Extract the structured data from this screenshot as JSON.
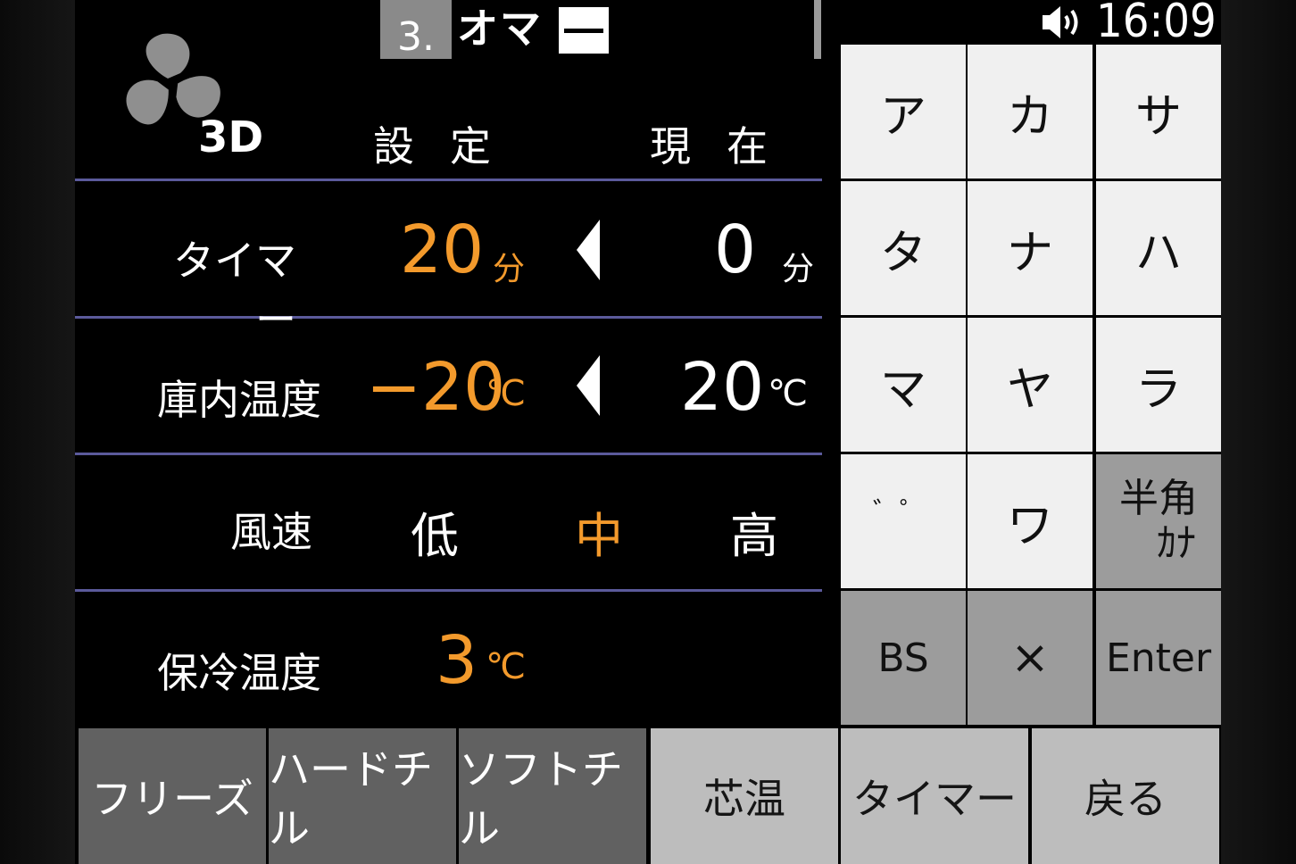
{
  "header": {
    "program_number": "3.",
    "program_name": "オマ",
    "clock": "16:09",
    "speaker_icon": "speaker-icon"
  },
  "mode": {
    "label": "3D",
    "fan_icon": "fan-icon"
  },
  "columns": {
    "set": "設定",
    "current": "現在"
  },
  "rows": {
    "timer": {
      "label": "タイマー",
      "set_value": "20",
      "set_unit": "分",
      "current_value": "0",
      "current_unit": "分"
    },
    "temperature": {
      "label": "庫内温度",
      "set_value": "−20",
      "set_unit": "℃",
      "current_value": "20",
      "current_unit": "℃"
    },
    "fan_speed": {
      "label": "風速",
      "options": [
        "低",
        "中",
        "高"
      ],
      "selected": "中"
    },
    "hold_temp": {
      "label": "保冷温度",
      "value": "3",
      "unit": "℃"
    }
  },
  "keypad": {
    "keys": [
      "ア",
      "カ",
      "サ",
      "タ",
      "ナ",
      "ハ",
      "マ",
      "ヤ",
      "ラ",
      "゛゜",
      "ワ"
    ],
    "halfwidth_line1": "半角",
    "halfwidth_line2": "ｶﾅ",
    "bs": "BS",
    "close": "×",
    "enter": "Enter"
  },
  "bottom_buttons": [
    "フリーズ",
    "ハードチル",
    "ソフトチル",
    "芯温",
    "タイマー",
    "戻る"
  ],
  "colors": {
    "accent": "#f39a2c",
    "divider": "#5b5a9b"
  }
}
